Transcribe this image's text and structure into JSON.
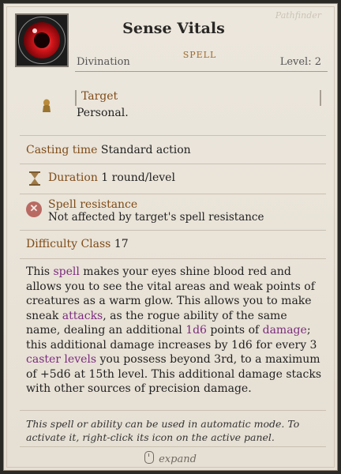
{
  "header": {
    "title": "Sense Vitals",
    "type_label": "SPELL",
    "school": "Divination",
    "level_label": "Level: 2",
    "signature": "Pathfinder"
  },
  "target": {
    "label": "Target",
    "value": "Personal."
  },
  "casting_time": {
    "label": "Casting time",
    "value": "Standard action"
  },
  "duration": {
    "label": "Duration",
    "value": "1 round/level"
  },
  "spell_resistance": {
    "label": "Spell resistance",
    "value": "Not affected by target's spell resistance"
  },
  "difficulty_class": {
    "label": "Difficulty Class",
    "value": "17"
  },
  "description": {
    "p1": "This ",
    "k1": "spell",
    "p2": " makes your eyes shine blood red and allows you to see the vital areas and weak points of creatures as a warm glow. This allows you to make sneak ",
    "k2": "attacks",
    "p3": ", as the rogue ability of the same name, dealing an additional ",
    "k3": "1d6",
    "p4": " points of ",
    "k4": "damage",
    "p5": "; this additional damage increases by 1d6 for every 3 ",
    "k5": "caster levels",
    "p6": " you possess beyond 3rd, to a maximum of +5d6 at 15th level. This additional damage stacks with other sources of precision damage."
  },
  "footer_note": "This spell or ability can be used in automatic mode. To activate it, right-click its icon on the active panel.",
  "expand_label": "expand",
  "colors": {
    "label": "#7f4b17",
    "keyword": "#7b2b7e",
    "background": "#ece7dd"
  },
  "icons": [
    "sense-vitals-spell-icon",
    "target-personal-icon",
    "hourglass-icon",
    "spell-resistance-x-icon",
    "mouse-icon"
  ]
}
